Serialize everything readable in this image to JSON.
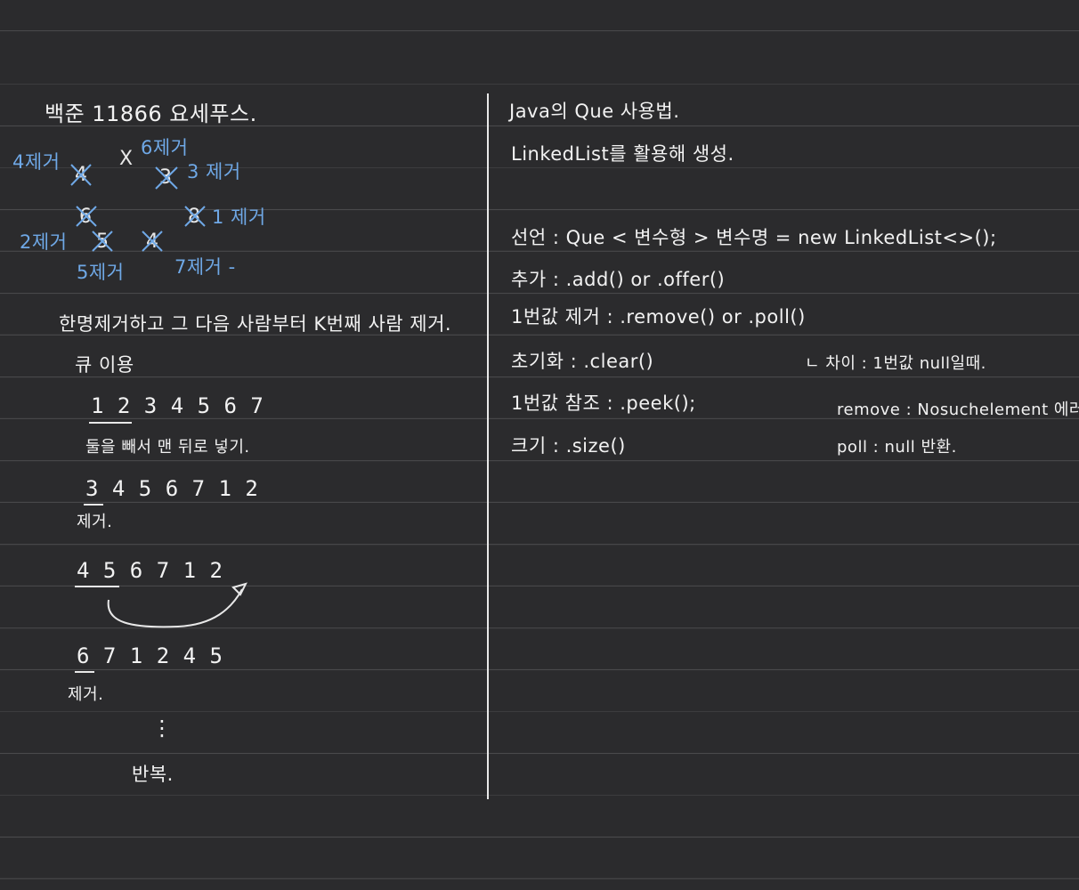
{
  "title": "백준 11866 요세푸스.",
  "diagram": {
    "labels": [
      "4제거",
      "6제거",
      "3 제거",
      "1 제거",
      "2제거",
      "5제거",
      "7제거 -"
    ]
  },
  "left": {
    "rule": "한명제거하고 그 다음 사람부터 K번째 사람 제거.",
    "queue_use": "큐 이용",
    "seq1": "1 2 3 4 5 6 7",
    "note1": "둘을 빼서 맨 뒤로 넣기.",
    "seq2": "3 4 5 6 7 1 2",
    "remove1": "제거.",
    "seq3": "4 5 6 7 1 2",
    "seq4": "6 7 1 2 4 5",
    "remove2": "제거.",
    "dots": "⋮",
    "repeat": "반복."
  },
  "right": {
    "heading": "Java의 Que 사용법.",
    "linkedlist": "LinkedList를 활용해 생성.",
    "declare": "선언 : Que < 변수형 > 변수명 = new LinkedList<>();",
    "add": "추가 : .add() or .offer()",
    "remove_first": "1번값 제거 : .remove() or .poll()",
    "init": "초기화 : .clear()",
    "peek": "1번값 참조 : .peek();",
    "size": "크기 : .size()",
    "diff_title": "ㄴ 차이 : 1번값 null일때.",
    "diff_remove": "remove : Nosuchelement 에러",
    "diff_poll": "poll : null 반환."
  }
}
